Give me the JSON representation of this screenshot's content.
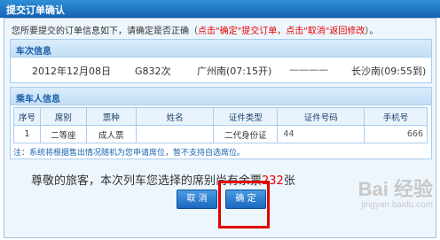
{
  "dialog": {
    "title": "提交订单确认",
    "intro_prefix": "您所要提交的订单信息如下，请确定是否正确（",
    "intro_red": "点击\"确定\"提交订单，点击\"取消\"返回修改",
    "intro_suffix": "）。"
  },
  "train_section": {
    "header": "车次信息",
    "date": "2012年12月08日",
    "train_no": "G832次",
    "from": "广州南(07:15开)",
    "separator": "————",
    "to": "长沙南(09:55到)"
  },
  "passenger_section": {
    "header": "乘车人信息",
    "columns": [
      "序号",
      "席别",
      "票种",
      "姓名",
      "证件类型",
      "证件号码",
      "手机号"
    ],
    "rows": [
      [
        "1",
        "二等座",
        "成人票",
        "",
        "二代身份证",
        "44",
        "666"
      ]
    ]
  },
  "note": "注：系统将根据售出情况随机为您申请席位，暂不支持自选席位。",
  "remaining": {
    "prefix": "尊敬的旅客，本次列车您选择的席别尚有余票",
    "count": "232",
    "suffix": "张"
  },
  "buttons": {
    "cancel": "取 消",
    "confirm": "确 定"
  },
  "watermark": {
    "logo": "Bai 经验",
    "url": "jingyan.baidu.com"
  }
}
